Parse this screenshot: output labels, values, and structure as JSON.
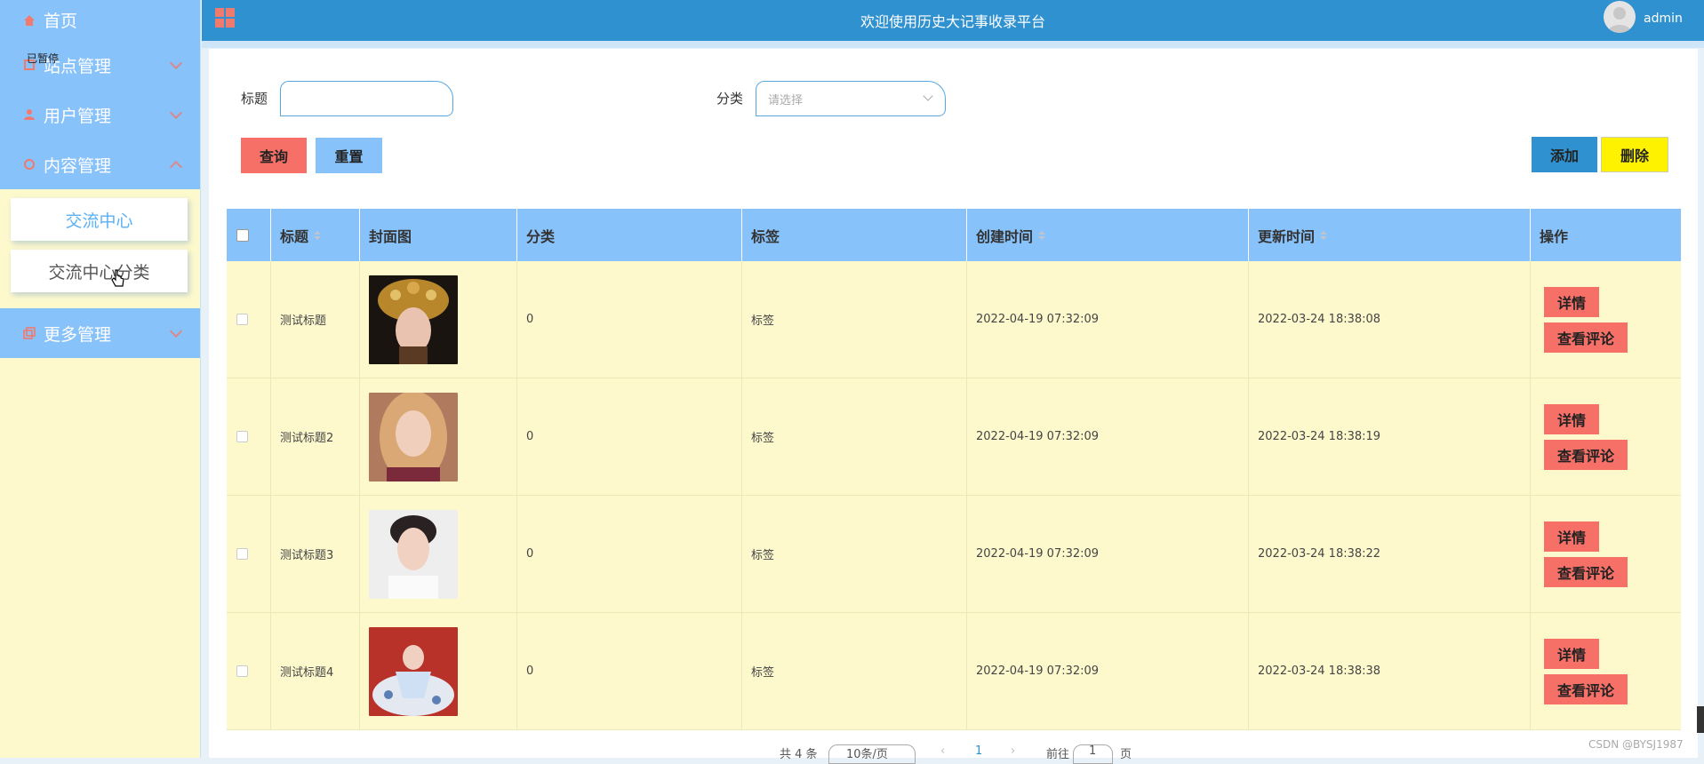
{
  "sidebar": {
    "home": "首页",
    "tooltip": "已暂停",
    "groups": [
      {
        "label": "站点管理"
      },
      {
        "label": "用户管理"
      },
      {
        "label": "内容管理"
      }
    ],
    "sub_items": [
      "交流中心",
      "交流中心分类"
    ],
    "more": "更多管理"
  },
  "header": {
    "title": "欢迎使用历史大记事收录平台",
    "user": "admin"
  },
  "search": {
    "title_label": "标题",
    "title_value": "",
    "category_label": "分类",
    "category_placeholder": "请选择",
    "query_btn": "查询",
    "reset_btn": "重置",
    "add_btn": "添加",
    "delete_btn": "删除"
  },
  "table": {
    "headers": [
      "标题",
      "封面图",
      "分类",
      "标签",
      "创建时间",
      "更新时间",
      "操作"
    ],
    "rows": [
      {
        "title": "测试标题",
        "category": "0",
        "tag": "标签",
        "created": "2022-04-19 07:32:09",
        "updated": "2022-03-24 18:38:08"
      },
      {
        "title": "测试标题2",
        "category": "0",
        "tag": "标签",
        "created": "2022-04-19 07:32:09",
        "updated": "2022-03-24 18:38:19"
      },
      {
        "title": "测试标题3",
        "category": "0",
        "tag": "标签",
        "created": "2022-04-19 07:32:09",
        "updated": "2022-03-24 18:38:22"
      },
      {
        "title": "测试标题4",
        "category": "0",
        "tag": "标签",
        "created": "2022-04-19 07:32:09",
        "updated": "2022-03-24 18:38:38"
      }
    ],
    "detail_btn": "详情",
    "comment_btn": "查看评论"
  },
  "pagination": {
    "total": "共 4 条",
    "page_size": "10条/页",
    "current": "1",
    "goto": "前往",
    "goto_value": "1",
    "page_unit": "页"
  },
  "watermark": "CSDN @BYSJ1987",
  "colors": {
    "sidebar_bg": "#fdf9cd",
    "menu_bg": "#88c2fb",
    "header_bg": "#2f91d0",
    "danger": "#f77067",
    "delete": "#fff200"
  }
}
